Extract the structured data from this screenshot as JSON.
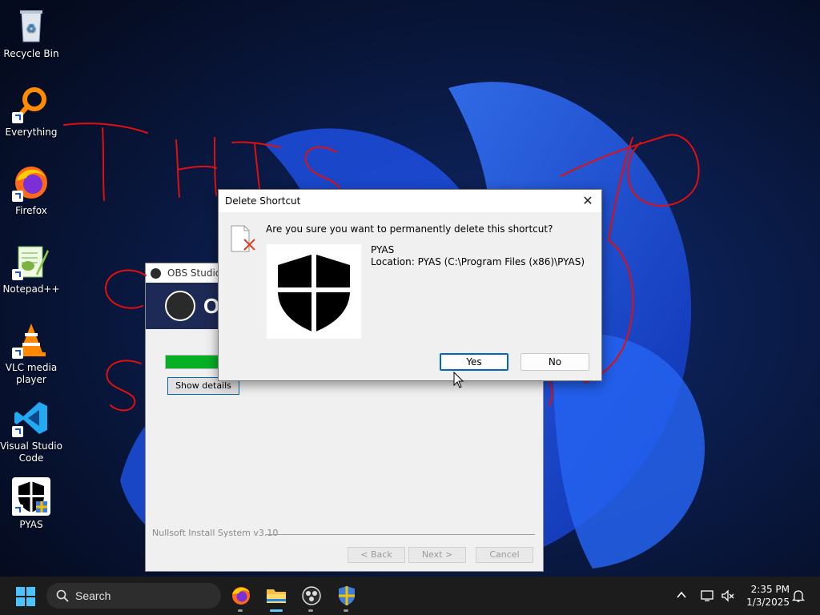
{
  "desktop": {
    "icons": [
      {
        "label": "Recycle Bin"
      },
      {
        "label": "Everything"
      },
      {
        "label": "Firefox"
      },
      {
        "label": "Notepad++"
      },
      {
        "label": "VLC media player"
      },
      {
        "label": "Visual Studio Code"
      },
      {
        "label": "PYAS"
      }
    ]
  },
  "obs_installer": {
    "title": "OBS Studio 3",
    "banner_text": "O",
    "progress_fraction": 0.15,
    "show_details_label": "Show details",
    "footer_label": "Nullsoft Install System v3.10",
    "back_label": "< Back",
    "next_label": "Next >",
    "cancel_label": "Cancel"
  },
  "dialog": {
    "title": "Delete Shortcut",
    "close_glyph": "✕",
    "question": "Are you sure you want to permanently delete this shortcut?",
    "item_name": "PYAS",
    "item_location": "Location: PYAS (C:\\Program Files (x86)\\PYAS)",
    "yes_label": "Yes",
    "no_label": "No"
  },
  "taskbar": {
    "search_placeholder": "Search",
    "pinned_apps": [
      "firefox-icon",
      "file-explorer-icon",
      "obs-icon",
      "security-shield-icon"
    ],
    "time": "2:35 PM",
    "date": "1/3/2025"
  },
  "colors": {
    "accent": "#0067c0",
    "annotation_red": "#e01010",
    "progress_green": "#06b025"
  }
}
